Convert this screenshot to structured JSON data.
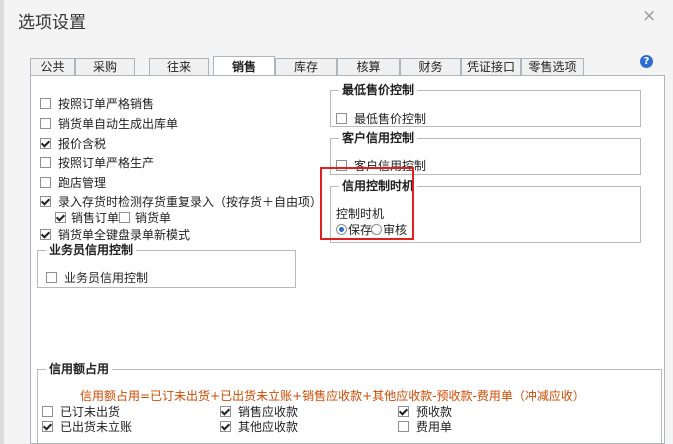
{
  "dialog": {
    "title": "选项设置",
    "close_symbol": "×"
  },
  "help_symbol": "?",
  "tabs": [
    {
      "label": "公共",
      "active": false
    },
    {
      "label": "采购",
      "active": false
    },
    {
      "label": "往来",
      "active": false
    },
    {
      "label": "销售",
      "active": true
    },
    {
      "label": "库存",
      "active": false
    },
    {
      "label": "核算",
      "active": false
    },
    {
      "label": "财务",
      "active": false
    },
    {
      "label": "凭证接口",
      "active": false
    },
    {
      "label": "零售选项",
      "active": false
    }
  ],
  "left_options": [
    {
      "label": "按照订单严格销售",
      "checked": false
    },
    {
      "label": "销货单自动生成出库单",
      "checked": false
    },
    {
      "label": "报价含税",
      "checked": true
    },
    {
      "label": "按照订单严格生产",
      "checked": false
    },
    {
      "label": "跑店管理",
      "checked": false
    },
    {
      "label": "录入存货时检测存货重复录入（按存货＋自由项）",
      "checked": true
    }
  ],
  "sub_options": [
    {
      "label": "销售订单",
      "checked": true
    },
    {
      "label": "销货单",
      "checked": false
    }
  ],
  "full_key_option": {
    "label": "销货单全键盘录单新模式",
    "checked": true
  },
  "salesman_credit": {
    "title": "业务员信用控制",
    "option": {
      "label": "业务员信用控制",
      "checked": false
    }
  },
  "min_price": {
    "title": "最低售价控制",
    "option": {
      "label": "最低售价控制",
      "checked": false
    }
  },
  "customer_credit": {
    "title": "客户信用控制",
    "option": {
      "label": "客户信用控制",
      "checked": false
    }
  },
  "credit_timing": {
    "title": "信用控制时机",
    "label": "控制时机",
    "radios": [
      {
        "label": "保存",
        "checked": true
      },
      {
        "label": "审核",
        "checked": false
      }
    ]
  },
  "credit_usage": {
    "title": "信用额占用",
    "formula": "信用额占用=已订未出货+已出货未立账+销售应收款+其他应收款-预收款-费用单（冲减应收）",
    "options": [
      {
        "label": "已订未出货",
        "checked": false
      },
      {
        "label": "销售应收款",
        "checked": true
      },
      {
        "label": "预收款",
        "checked": true
      },
      {
        "label": "已出货未立账",
        "checked": true
      },
      {
        "label": "其他应收款",
        "checked": true
      },
      {
        "label": "费用单",
        "checked": false
      }
    ]
  }
}
